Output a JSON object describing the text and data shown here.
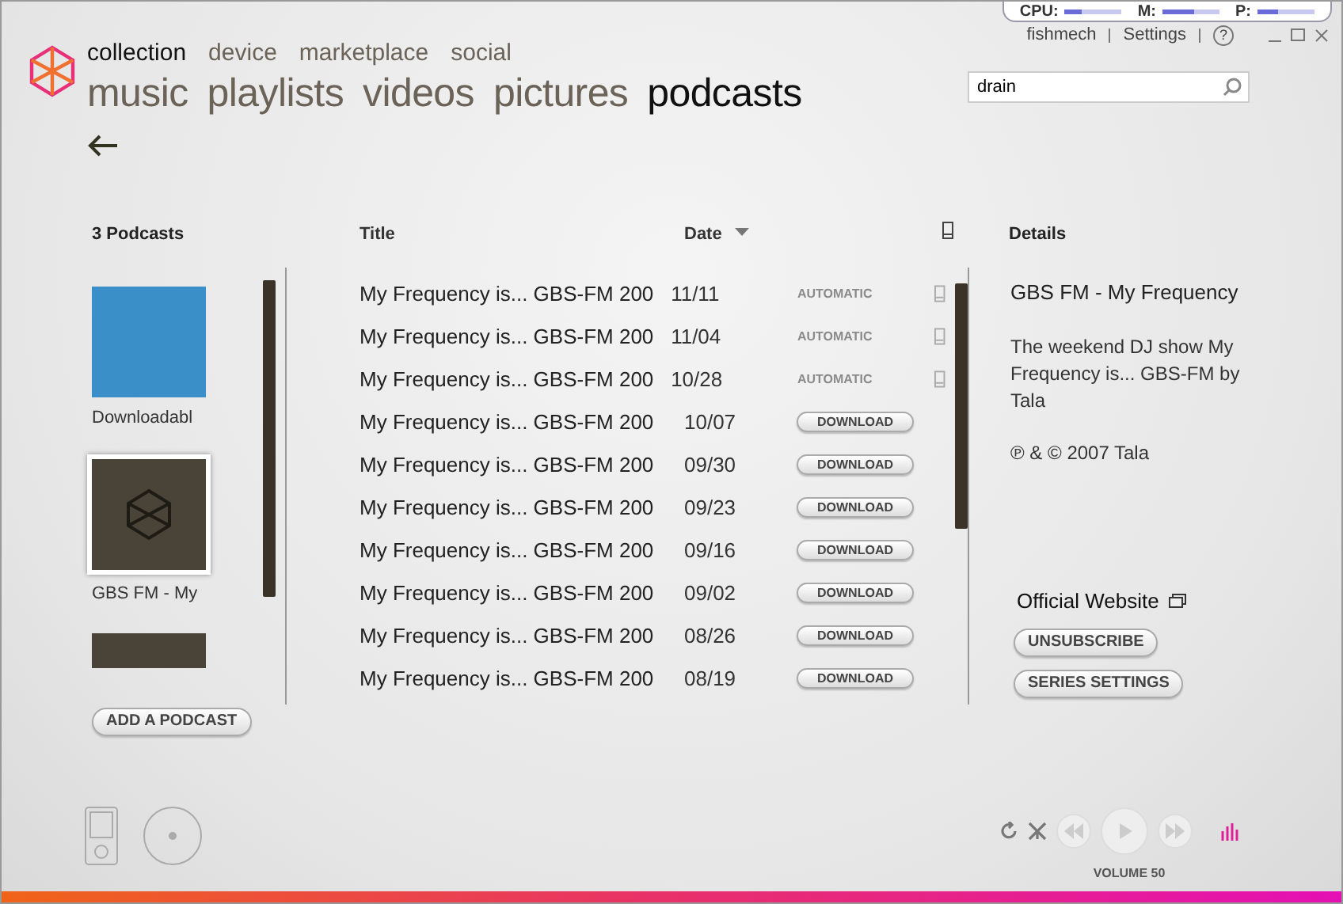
{
  "meters": [
    {
      "label": "CPU:",
      "level": 0.3
    },
    {
      "label": "M:",
      "level": 0.55
    },
    {
      "label": "P:",
      "level": 0.35
    }
  ],
  "top_links": [
    {
      "kind": "link",
      "text": "fishmech"
    },
    {
      "kind": "link",
      "text": "Settings"
    },
    {
      "kind": "help",
      "text": "?"
    }
  ],
  "pivots": [
    {
      "label": "collection",
      "selected": true
    },
    {
      "label": "device",
      "selected": false
    },
    {
      "label": "marketplace",
      "selected": false
    },
    {
      "label": "social",
      "selected": false
    }
  ],
  "categories": [
    {
      "label": "music",
      "selected": false
    },
    {
      "label": "playlists",
      "selected": false
    },
    {
      "label": "videos",
      "selected": false
    },
    {
      "label": "pictures",
      "selected": false
    },
    {
      "label": "podcasts",
      "selected": true
    }
  ],
  "search": {
    "value": "drain"
  },
  "podcasts": {
    "header": "3 Podcasts",
    "items": [
      {
        "kind": "photo",
        "label": "Downloadabl",
        "selected": false
      },
      {
        "kind": "logo",
        "label": "GBS FM - My",
        "selected": true
      },
      {
        "kind": "plain",
        "selected": false
      }
    ],
    "add_button": "ADD A PODCAST"
  },
  "episodes": {
    "columns": [
      {
        "label": "Title",
        "sorted": false
      },
      {
        "label": "Date",
        "sorted": true
      }
    ],
    "rows": [
      {
        "title": "My Frequency is... GBS-FM 200",
        "date": "11/11",
        "kind": "automatic",
        "action": "AUTOMATIC",
        "on_device": true
      },
      {
        "title": "My Frequency is... GBS-FM 200",
        "date": "11/04",
        "kind": "automatic",
        "action": "AUTOMATIC",
        "on_device": true
      },
      {
        "title": "My Frequency is... GBS-FM 200",
        "date": "10/28",
        "kind": "automatic",
        "action": "AUTOMATIC",
        "on_device": true
      },
      {
        "title": "My Frequency is... GBS-FM 200",
        "date": "10/07",
        "kind": "download",
        "action": "DOWNLOAD",
        "on_device": false
      },
      {
        "title": "My Frequency is... GBS-FM 200",
        "date": "09/30",
        "kind": "download",
        "action": "DOWNLOAD",
        "on_device": false
      },
      {
        "title": "My Frequency is... GBS-FM 200",
        "date": "09/23",
        "kind": "download",
        "action": "DOWNLOAD",
        "on_device": false
      },
      {
        "title": "My Frequency is... GBS-FM 200",
        "date": "09/16",
        "kind": "download",
        "action": "DOWNLOAD",
        "on_device": false
      },
      {
        "title": "My Frequency is... GBS-FM 200",
        "date": "09/02",
        "kind": "download",
        "action": "DOWNLOAD",
        "on_device": false
      },
      {
        "title": "My Frequency is... GBS-FM 200",
        "date": "08/26",
        "kind": "download",
        "action": "DOWNLOAD",
        "on_device": false
      },
      {
        "title": "My Frequency is... GBS-FM 200",
        "date": "08/19",
        "kind": "download",
        "action": "DOWNLOAD",
        "on_device": false
      }
    ]
  },
  "details": {
    "header": "Details",
    "title": "GBS FM - My Frequency",
    "description": "The weekend DJ show My Frequency is... GBS-FM by Tala",
    "copyright": "℗ & © 2007 Tala",
    "website": "Official Website",
    "buttons": [
      "UNSUBSCRIBE",
      "SERIES SETTINGS"
    ]
  },
  "player": {
    "volume": "VOLUME 50"
  }
}
